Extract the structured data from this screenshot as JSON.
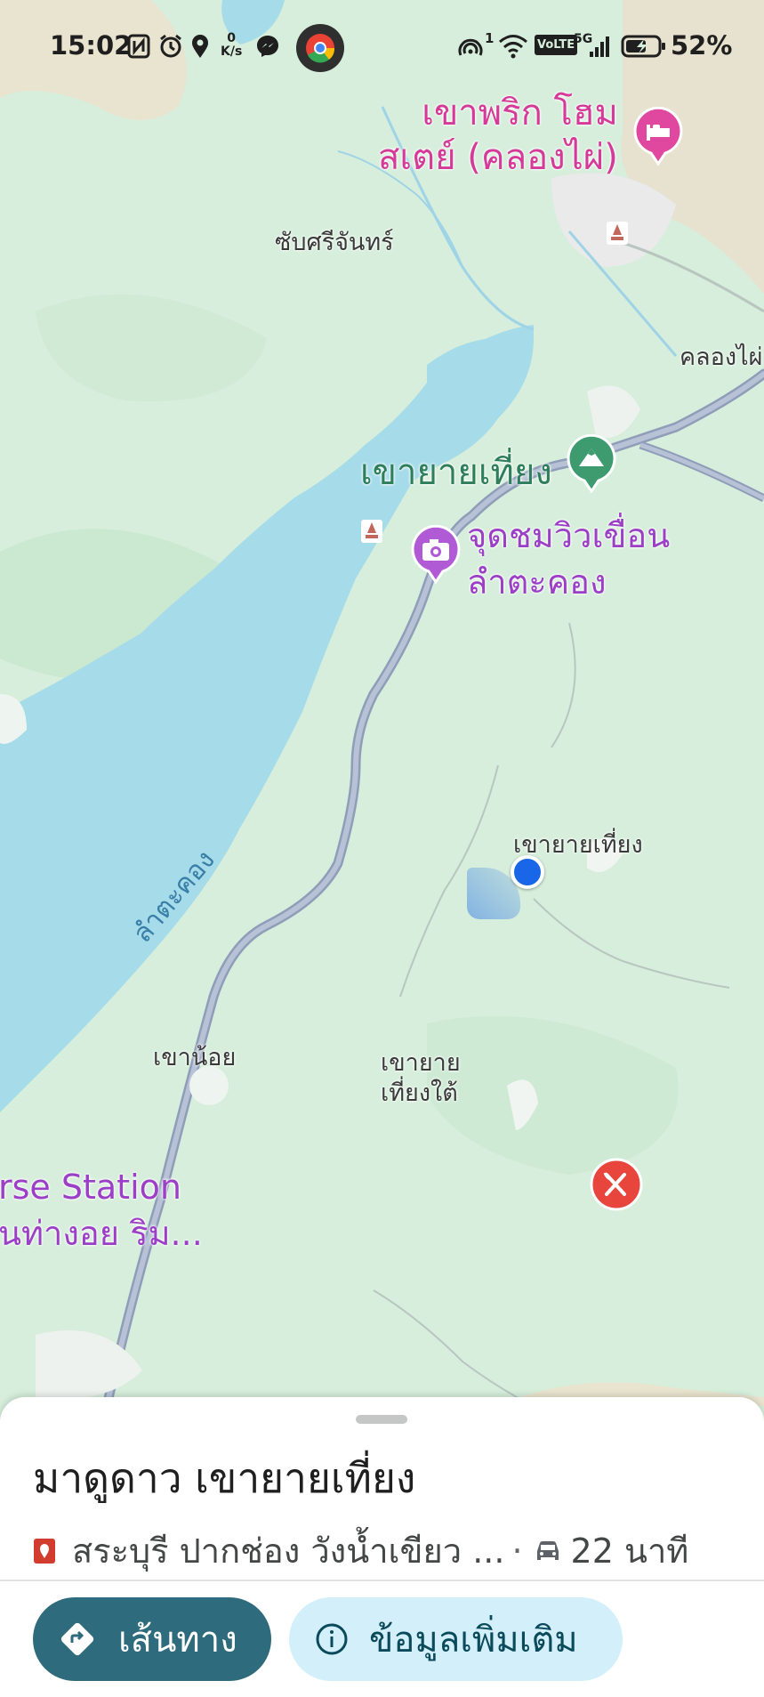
{
  "status_bar": {
    "time": "15:02",
    "net_speed_value": "0",
    "net_speed_unit": "K/s",
    "signal_badge": "1",
    "volte": "VoLTE",
    "network": "5G",
    "battery": "52%",
    "icons": [
      "nfc-icon",
      "alarm-icon",
      "location-icon",
      "messenger-icon",
      "chrome-icon",
      "hotspot-icon",
      "wifi-icon",
      "signal-icon",
      "battery-charging-icon"
    ]
  },
  "map": {
    "labels": {
      "homestay_line1": "เขาพริก โฮม",
      "homestay_line2": "สเตย์ (คลองไผ่)",
      "sap_sri_chan": "ซับศรีจันทร์",
      "khlong_phai": "คลองไผ่",
      "khao_yai_thiang_poi": "เขายายเที่ยง",
      "viewpoint_line1": "จุดชมวิวเขื่อน",
      "viewpoint_line2": "ลำตะคอง",
      "reservoir": "ลำตะคอง",
      "khao_yai_thiang_place": "เขายายเที่ยง",
      "khao_noi": "เขาน้อย",
      "khao_yai_thiang_tai_line1": "เขายาย",
      "khao_yai_thiang_tai_line2": "เที่ยงใต้",
      "horse_station_line1": "rse Station",
      "horse_station_line2": "นท่างอย ริม..."
    },
    "colors": {
      "land": "#d6eedb",
      "water": "#a6dbea",
      "road": "#a7b3c8",
      "hotel_pin": "#e0479e",
      "park_pin": "#3d9b6f",
      "viewpoint_pin": "#b05ad6",
      "restaurant_pin": "#e8453c",
      "my_location": "#1a66e8"
    }
  },
  "sheet": {
    "title": "มาดูดาว เขายายเที่ยง",
    "address": "สระบุรี ปากช่อง วังน้ำเขียว ...",
    "separator": "·",
    "drive_time": "22 นาที",
    "directions_label": "เส้นทาง",
    "more_info_label": "ข้อมูลเพิ่มเติม"
  }
}
